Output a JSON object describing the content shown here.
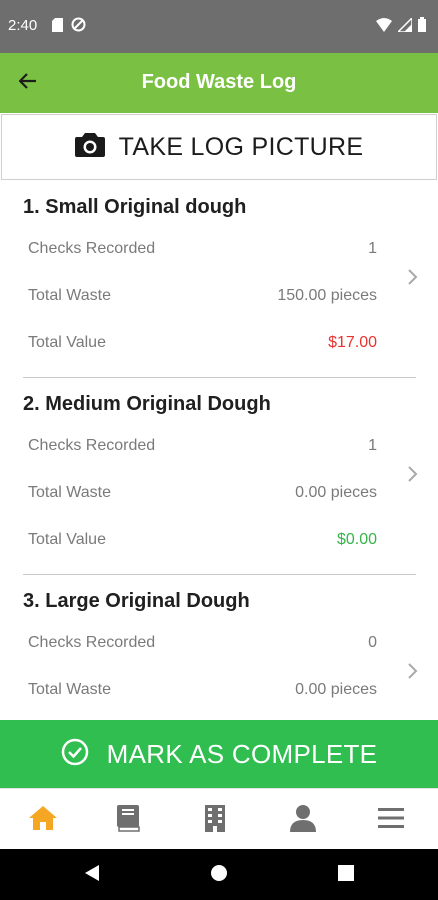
{
  "status_bar": {
    "time": "2:40",
    "icons": [
      "sd-card-icon",
      "data-saver-icon",
      "wifi-icon",
      "signal-icon",
      "battery-icon"
    ]
  },
  "header": {
    "title": "Food Waste Log",
    "back_icon": "arrow-left-icon",
    "color": "#7ac143"
  },
  "photo_button": {
    "label": "TAKE LOG PICTURE",
    "icon": "camera-icon"
  },
  "items": [
    {
      "title": "1. Small Original dough",
      "rows": [
        {
          "label": "Checks Recorded",
          "value": "1"
        },
        {
          "label": "Total Waste",
          "value": "150.00 pieces"
        },
        {
          "label": "Total Value",
          "value": "$17.00",
          "value_color": "#e8332f"
        }
      ]
    },
    {
      "title": "2. Medium Original Dough",
      "rows": [
        {
          "label": "Checks Recorded",
          "value": "1"
        },
        {
          "label": "Total Waste",
          "value": "0.00 pieces"
        },
        {
          "label": "Total Value",
          "value": "$0.00",
          "value_color": "#36b34a"
        }
      ]
    },
    {
      "title": "3. Large Original Dough",
      "rows": [
        {
          "label": "Checks Recorded",
          "value": "0"
        },
        {
          "label": "Total Waste",
          "value": "0.00 pieces"
        }
      ]
    }
  ],
  "complete_button": {
    "label": "MARK AS COMPLETE",
    "icon": "check-circle-icon",
    "color": "#2fbe4f"
  },
  "bottom_nav": {
    "items": [
      "home-icon",
      "book-icon",
      "building-icon",
      "person-icon",
      "menu-icon"
    ],
    "active_color": "#f5a623",
    "inactive_color": "#6f6f6f"
  },
  "system_nav": [
    "back-triangle-icon",
    "home-circle-icon",
    "recents-square-icon"
  ]
}
